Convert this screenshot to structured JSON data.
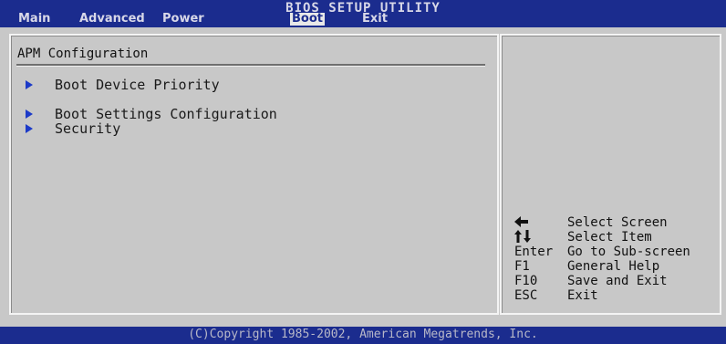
{
  "header": {
    "title": "BIOS SETUP UTILITY",
    "tabs": [
      {
        "label": "Main"
      },
      {
        "label": "Advanced"
      },
      {
        "label": "Power"
      },
      {
        "label": "Boot",
        "active": true
      },
      {
        "label": "Exit"
      }
    ]
  },
  "main": {
    "section_title": "APM Configuration",
    "items": [
      {
        "label": "Boot Device Priority"
      },
      {
        "label": "Boot Settings Configuration"
      },
      {
        "label": "Security"
      }
    ]
  },
  "help": {
    "keys": [
      {
        "key": "",
        "icon": "left-arrow-icon",
        "desc": "Select Screen"
      },
      {
        "key": "",
        "icon": "up-down-arrows-icon",
        "desc": "Select Item"
      },
      {
        "key": "Enter",
        "desc": "Go to Sub-screen"
      },
      {
        "key": "F1",
        "desc": "General Help"
      },
      {
        "key": "F10",
        "desc": "Save and Exit"
      },
      {
        "key": "ESC",
        "desc": "Exit"
      }
    ]
  },
  "footer": {
    "copyright": "(C)Copyright 1985-2002, American Megatrends, Inc."
  },
  "colors": {
    "bar_blue": "#1b2c8e",
    "panel_gray": "#c8c8c8",
    "arrow_blue": "#1c3ac8"
  }
}
